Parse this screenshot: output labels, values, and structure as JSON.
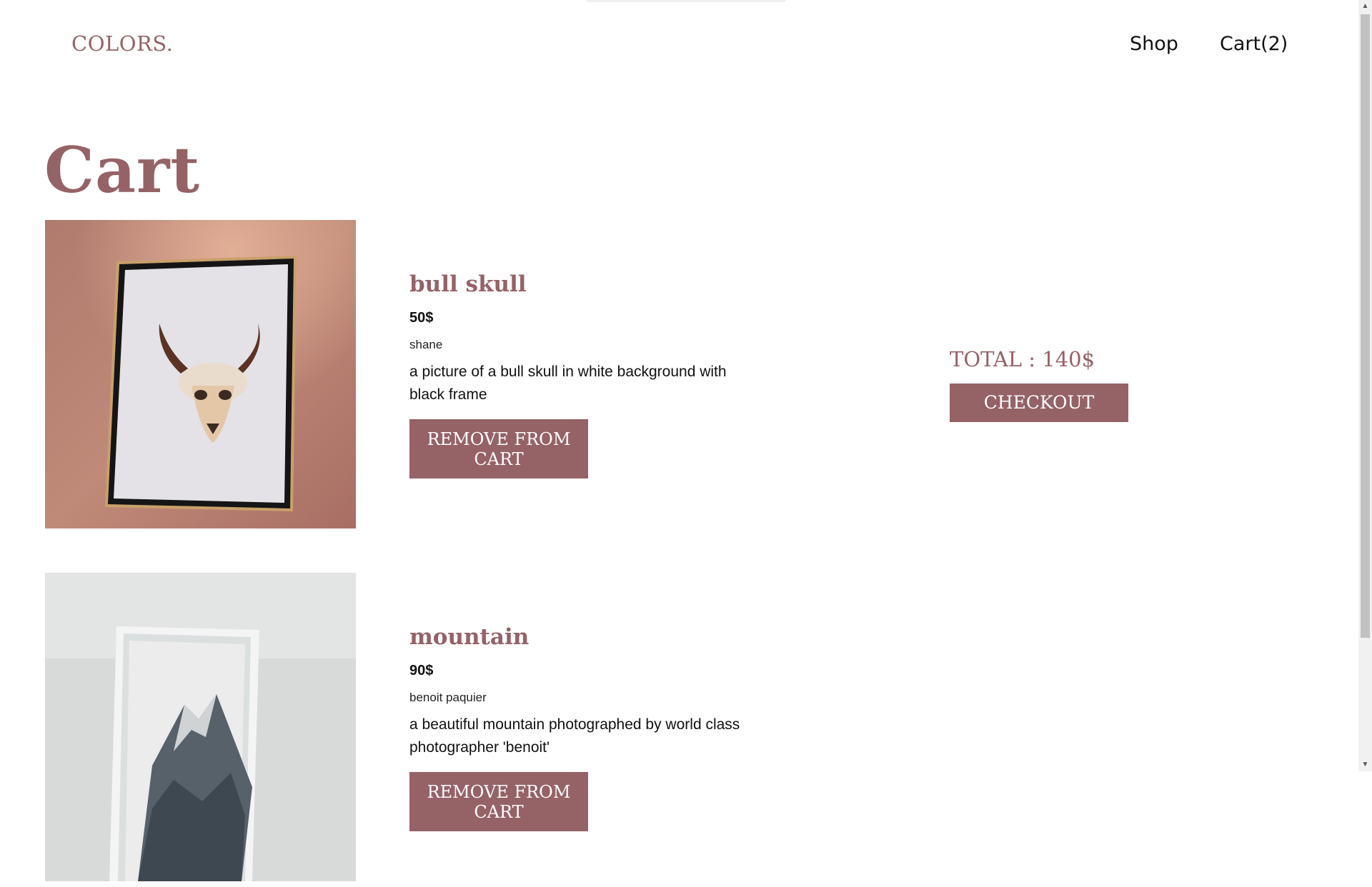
{
  "header": {
    "brand": "COLORS.",
    "nav": {
      "shop": "Shop",
      "cart": "Cart(2)"
    }
  },
  "page": {
    "title": "Cart"
  },
  "items": [
    {
      "name": "bull skull",
      "price": "50$",
      "artist": "shane",
      "description": "a picture of a bull skull in white background with black frame",
      "remove_label": "REMOVE FROM CART"
    },
    {
      "name": "mountain",
      "price": "90$",
      "artist": "benoit paquier",
      "description": "a beautiful mountain photographed by world class photographer 'benoit'",
      "remove_label": "REMOVE FROM CART"
    }
  ],
  "summary": {
    "total": "TOTAL : 140$",
    "checkout_label": "CHECKOUT"
  },
  "colors": {
    "accent": "#956266"
  }
}
